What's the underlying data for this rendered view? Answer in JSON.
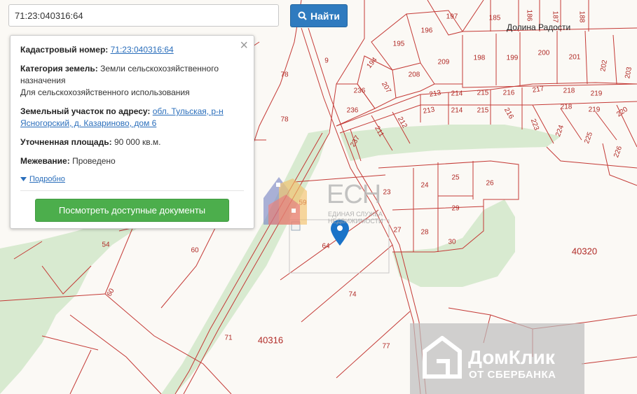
{
  "search": {
    "value": "71:23:040316:64",
    "button_label": "Найти"
  },
  "info": {
    "cadastral_label": "Кадастровый номер:",
    "cadastral_value": "71:23:040316:64",
    "category_label": "Категория земель:",
    "category_value": "Земли сельскохозяйственного назначения",
    "category_use": "Для сельскохозяйственного использования",
    "address_label": "Земельный участок по адресу:",
    "address_value": "обл. Тульская, р-н Ясногорский, д. Казариново, дом 6",
    "area_label": "Уточненная площадь:",
    "area_value": "90 000 кв.м.",
    "survey_label": "Межевание:",
    "survey_value": "Проведено",
    "more_link": "Подробно",
    "docs_button": "Посмотреть доступные документы"
  },
  "map": {
    "place_name": "Долина Радости",
    "block_labels": [
      "40316",
      "40320"
    ],
    "plot_labels": [
      "197",
      "185",
      "186",
      "187",
      "188",
      "196",
      "195",
      "209",
      "198",
      "199",
      "200",
      "201",
      "202",
      "203",
      "194",
      "208",
      "207",
      "236",
      "213",
      "214",
      "215",
      "216",
      "217",
      "218",
      "219",
      "220",
      "223",
      "224",
      "225",
      "226",
      "237",
      "211",
      "212",
      "9",
      "78",
      "23",
      "24",
      "25",
      "26",
      "29",
      "27",
      "28",
      "30",
      "59",
      "64",
      "74",
      "71",
      "77",
      "54",
      "60",
      "60"
    ],
    "logo_letters": "ЕСН",
    "logo_sub1": "ЕДИНАЯ СЛУЖБА",
    "logo_sub2": "НЕДВИЖИМОСТИ"
  },
  "watermark": {
    "line1": "ДомКлик",
    "line2": "ОТ СБЕРБАНКА"
  },
  "colors": {
    "plot_line": "#c43a36",
    "green_area": "#d8ead0",
    "button_blue": "#2f7bbf",
    "button_green": "#4cae4c"
  }
}
